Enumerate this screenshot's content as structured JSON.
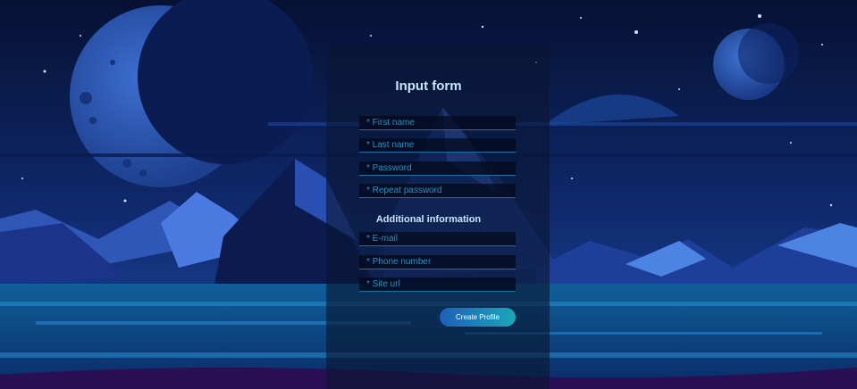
{
  "form": {
    "title": "Input form",
    "fields": [
      {
        "placeholder": "* First name"
      },
      {
        "placeholder": "* Last name"
      },
      {
        "placeholder": "* Password"
      },
      {
        "placeholder": "* Repeat password"
      }
    ],
    "additional_title": "Additional information",
    "additional_fields": [
      {
        "placeholder": "* E-mail"
      },
      {
        "placeholder": "* Phone number"
      },
      {
        "placeholder": "* Site url"
      }
    ],
    "submit_label": "Create Profile"
  },
  "colors": {
    "sky_top": "#0a1746",
    "sky_bottom": "#1b3f8f",
    "accent": "#1aa7b8",
    "text": "#c9e6ff"
  }
}
